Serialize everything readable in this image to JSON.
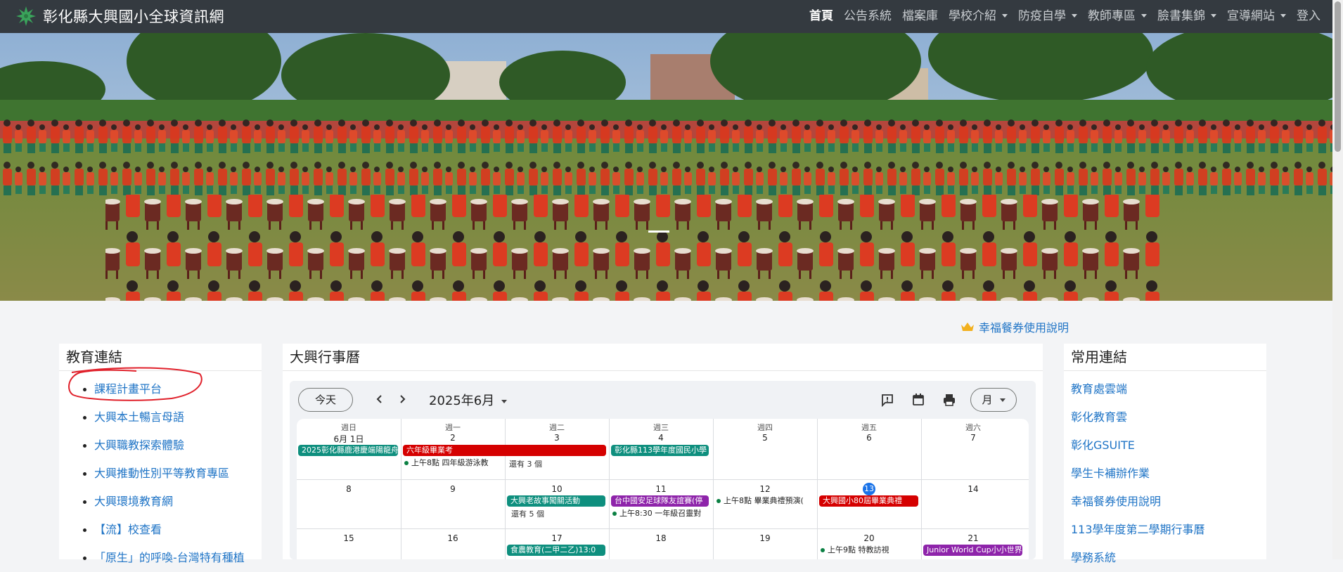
{
  "navbar": {
    "title": "彰化縣大興國小全球資訊網",
    "items": [
      {
        "label": "首頁"
      },
      {
        "label": "公告系統"
      },
      {
        "label": "檔案庫"
      },
      {
        "label": "學校介紹"
      },
      {
        "label": "防疫自學"
      },
      {
        "label": "教師專區"
      },
      {
        "label": "臉書集錦"
      },
      {
        "label": "宣導網站"
      },
      {
        "label": "登入"
      }
    ]
  },
  "promo_link": {
    "label": "幸福餐券使用說明",
    "icon": "crown-icon"
  },
  "left_panel": {
    "title": "教育連結",
    "links": [
      "課程計畫平台",
      "大興本土暢言母語",
      "大興職教探索體驗",
      "大興推動性別平等教育專區",
      "大興環境教育網",
      "【流】校查看",
      "「原生」的呼喚-台灣特有種植"
    ]
  },
  "calendar": {
    "title": "大興行事曆",
    "today_label": "今天",
    "month_label": "2025年6月",
    "view_label": "月",
    "weekdays": [
      "週日",
      "週一",
      "週二",
      "週三",
      "週四",
      "週五",
      "週六"
    ],
    "weeks": [
      [
        "6月 1日",
        "2",
        "3",
        "4",
        "5",
        "6",
        "7"
      ],
      [
        "8",
        "9",
        "10",
        "11",
        "12",
        "13",
        "14"
      ],
      [
        "15",
        "16",
        "17",
        "18",
        "19",
        "20",
        "21"
      ]
    ],
    "events": {
      "e1": "2025彰化縣鹿港慶端陽龍舟",
      "e2": "六年級畢業考",
      "e3": "彰化縣113學年度國民小學",
      "e4": "上午8點 四年級游泳教",
      "e5": "還有 3 個",
      "e6": "大興老故事闖關活動",
      "e7": "台中國安足球隊友誼賽(停",
      "e8": "上午8點 畢業典禮預演(",
      "e9": "大興國小80屆畢業典禮",
      "e10": "還有 5 個",
      "e11": "上午8:30 一年級召靈對",
      "e12": "食農教育(二甲二乙)13:0",
      "e13": "上午9點 特教訪視",
      "e14": "Junior World Cup小小世界"
    },
    "colors": {
      "teal": "#0e8f7e",
      "red": "#d50000",
      "purple": "#8e24aa",
      "today": "#1a73e8"
    }
  },
  "right_panel": {
    "title": "常用連結",
    "links": [
      "教育處雲端",
      "彰化教育雲",
      "彰化GSUITE",
      "學生卡補辦作業",
      "幸福餐券使用說明",
      "113學年度第二學期行事曆",
      "學務系統"
    ]
  }
}
